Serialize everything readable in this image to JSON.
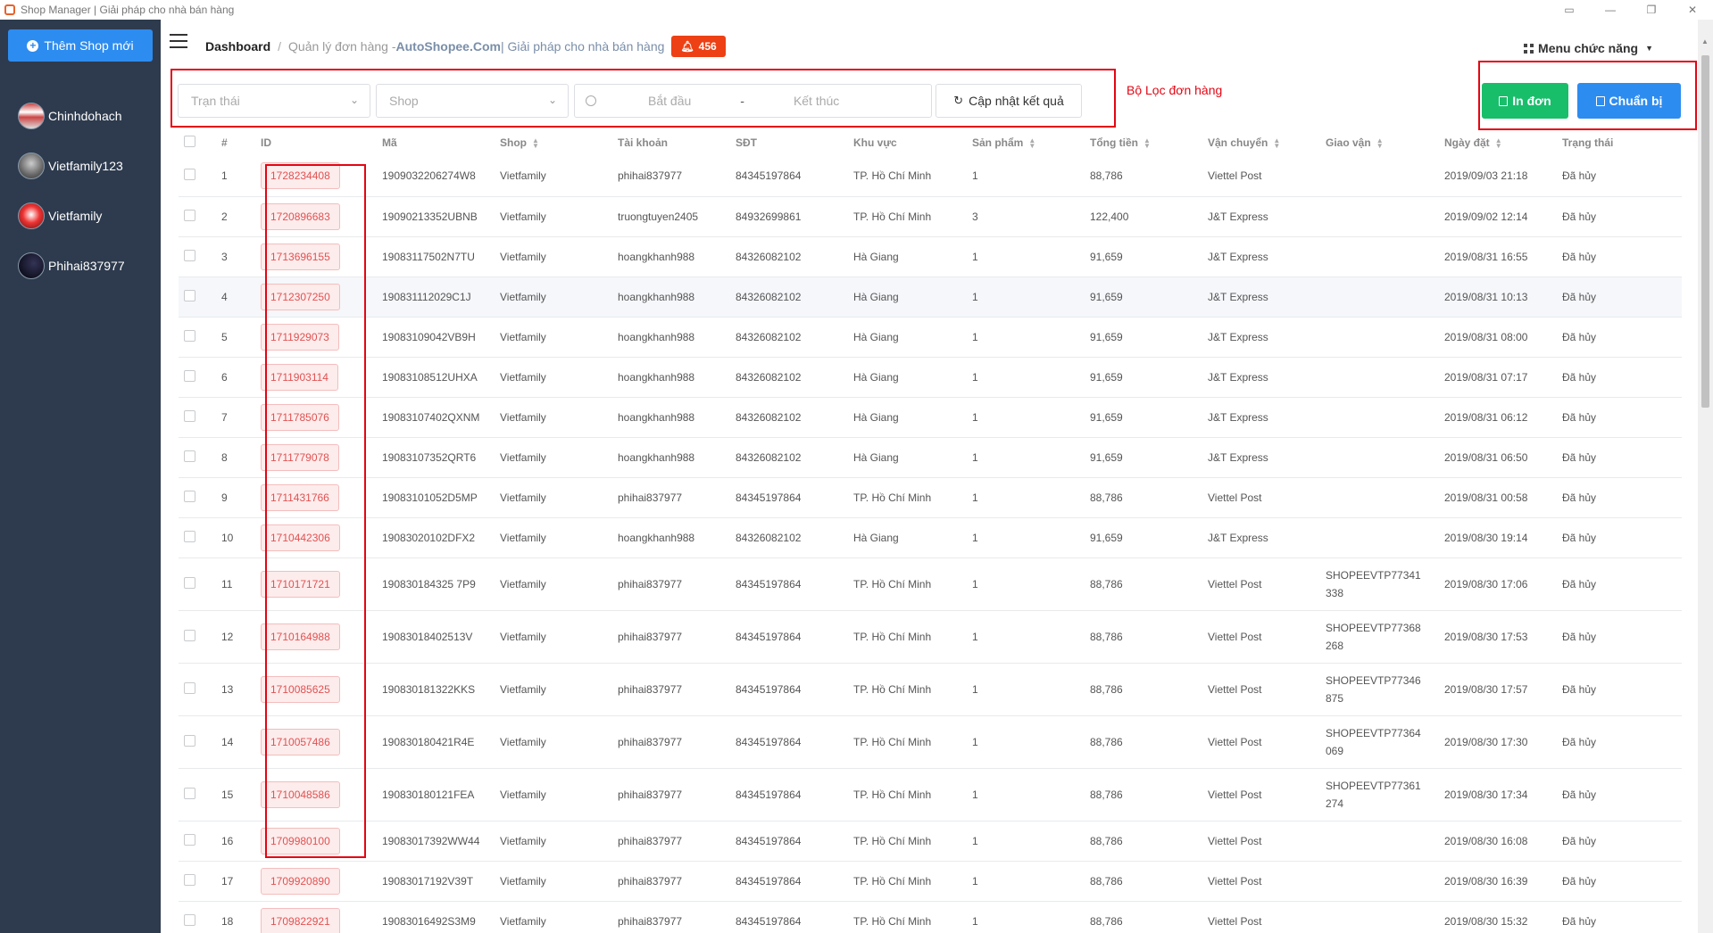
{
  "window": {
    "title": "Shop Manager | Giải pháp cho nhà bán hàng",
    "controls": [
      "▭",
      "—",
      "❐",
      "✕"
    ]
  },
  "sidebar": {
    "add_shop_label": "Thêm Shop mới",
    "shops": [
      {
        "name": "Chinhdohach"
      },
      {
        "name": "Vietfamily123"
      },
      {
        "name": "Vietfamily"
      },
      {
        "name": "Phihai837977"
      }
    ]
  },
  "header": {
    "breadcrumb_home": "Dashboard",
    "breadcrumb_sep": "/",
    "breadcrumb_page": "Quản lý đơn hàng - ",
    "breadcrumb_brand": "AutoShopee.Com",
    "breadcrumb_tail": " | Giải pháp cho nhà bán hàng",
    "notification_count": "456",
    "menu_label": "Menu chức năng"
  },
  "filters": {
    "status_placeholder": "Trạn thái",
    "shop_placeholder": "Shop",
    "start_placeholder": "Bắt đầu",
    "range_sep": "-",
    "end_placeholder": "Kết thúc",
    "refresh_label": "Cập nhật kết quả",
    "annotation": "Bộ Lọc đơn hàng"
  },
  "actions": {
    "print_label": "In đơn",
    "prepare_label": "Chuẩn bị"
  },
  "table": {
    "columns": [
      "#",
      "ID",
      "Mã",
      "Shop",
      "Tài khoản",
      "SĐT",
      "Khu vực",
      "Sản phẩm",
      "Tổng tiền",
      "Vận chuyển",
      "Giao vận",
      "Ngày đặt",
      "Trạng thái"
    ],
    "sortable": [
      false,
      false,
      false,
      true,
      false,
      false,
      false,
      true,
      true,
      true,
      true,
      true,
      false
    ],
    "rows": [
      {
        "num": "1",
        "id": "1728234408",
        "code": "1909032206274W8",
        "shop": "Vietfamily",
        "account": "phihai837977",
        "phone": "84345197864",
        "region": "TP. Hồ Chí Minh",
        "products": "1",
        "total": "88,786",
        "shipping": "Viettel Post",
        "tracking": "",
        "date": "2019/09/03 21:18",
        "status": "Đã hủy"
      },
      {
        "num": "2",
        "id": "1720896683",
        "code": "19090213352UBNB",
        "shop": "Vietfamily",
        "account": "truongtuyen2405",
        "phone": "84932699861",
        "region": "TP. Hồ Chí Minh",
        "products": "3",
        "total": "122,400",
        "shipping": "J&T Express",
        "tracking": "",
        "date": "2019/09/02 12:14",
        "status": "Đã hủy"
      },
      {
        "num": "3",
        "id": "1713696155",
        "code": "19083117502N7TU",
        "shop": "Vietfamily",
        "account": "hoangkhanh988",
        "phone": "84326082102",
        "region": "Hà Giang",
        "products": "1",
        "total": "91,659",
        "shipping": "J&T Express",
        "tracking": "",
        "date": "2019/08/31 16:55",
        "status": "Đã hủy"
      },
      {
        "num": "4",
        "id": "1712307250",
        "code": "190831112029C1J",
        "shop": "Vietfamily",
        "account": "hoangkhanh988",
        "phone": "84326082102",
        "region": "Hà Giang",
        "products": "1",
        "total": "91,659",
        "shipping": "J&T Express",
        "tracking": "",
        "date": "2019/08/31 10:13",
        "status": "Đã hủy"
      },
      {
        "num": "5",
        "id": "1711929073",
        "code": "19083109042VB9H",
        "shop": "Vietfamily",
        "account": "hoangkhanh988",
        "phone": "84326082102",
        "region": "Hà Giang",
        "products": "1",
        "total": "91,659",
        "shipping": "J&T Express",
        "tracking": "",
        "date": "2019/08/31 08:00",
        "status": "Đã hủy"
      },
      {
        "num": "6",
        "id": "1711903114",
        "code": "19083108512UHXA",
        "shop": "Vietfamily",
        "account": "hoangkhanh988",
        "phone": "84326082102",
        "region": "Hà Giang",
        "products": "1",
        "total": "91,659",
        "shipping": "J&T Express",
        "tracking": "",
        "date": "2019/08/31 07:17",
        "status": "Đã hủy"
      },
      {
        "num": "7",
        "id": "1711785076",
        "code": "19083107402QXNM",
        "shop": "Vietfamily",
        "account": "hoangkhanh988",
        "phone": "84326082102",
        "region": "Hà Giang",
        "products": "1",
        "total": "91,659",
        "shipping": "J&T Express",
        "tracking": "",
        "date": "2019/08/31 06:12",
        "status": "Đã hủy"
      },
      {
        "num": "8",
        "id": "1711779078",
        "code": "19083107352QRT6",
        "shop": "Vietfamily",
        "account": "hoangkhanh988",
        "phone": "84326082102",
        "region": "Hà Giang",
        "products": "1",
        "total": "91,659",
        "shipping": "J&T Express",
        "tracking": "",
        "date": "2019/08/31 06:50",
        "status": "Đã hủy"
      },
      {
        "num": "9",
        "id": "1711431766",
        "code": "19083101052D5MP",
        "shop": "Vietfamily",
        "account": "phihai837977",
        "phone": "84345197864",
        "region": "TP. Hồ Chí Minh",
        "products": "1",
        "total": "88,786",
        "shipping": "Viettel Post",
        "tracking": "",
        "date": "2019/08/31 00:58",
        "status": "Đã hủy"
      },
      {
        "num": "10",
        "id": "1710442306",
        "code": "19083020102DFX2",
        "shop": "Vietfamily",
        "account": "hoangkhanh988",
        "phone": "84326082102",
        "region": "Hà Giang",
        "products": "1",
        "total": "91,659",
        "shipping": "J&T Express",
        "tracking": "",
        "date": "2019/08/30 19:14",
        "status": "Đã hủy"
      },
      {
        "num": "11",
        "id": "1710171721",
        "code": "190830184325 7P9",
        "shop": "Vietfamily",
        "account": "phihai837977",
        "phone": "84345197864",
        "region": "TP. Hồ Chí Minh",
        "products": "1",
        "total": "88,786",
        "shipping": "Viettel Post",
        "tracking": "SHOPEEVTP77341 338",
        "date": "2019/08/30 17:06",
        "status": "Đã hủy"
      },
      {
        "num": "12",
        "id": "1710164988",
        "code": "19083018402513V",
        "shop": "Vietfamily",
        "account": "phihai837977",
        "phone": "84345197864",
        "region": "TP. Hồ Chí Minh",
        "products": "1",
        "total": "88,786",
        "shipping": "Viettel Post",
        "tracking": "SHOPEEVTP77368 268",
        "date": "2019/08/30 17:53",
        "status": "Đã hủy"
      },
      {
        "num": "13",
        "id": "1710085625",
        "code": "190830181322KKS",
        "shop": "Vietfamily",
        "account": "phihai837977",
        "phone": "84345197864",
        "region": "TP. Hồ Chí Minh",
        "products": "1",
        "total": "88,786",
        "shipping": "Viettel Post",
        "tracking": "SHOPEEVTP77346 875",
        "date": "2019/08/30 17:57",
        "status": "Đã hủy"
      },
      {
        "num": "14",
        "id": "1710057486",
        "code": "190830180421R4E",
        "shop": "Vietfamily",
        "account": "phihai837977",
        "phone": "84345197864",
        "region": "TP. Hồ Chí Minh",
        "products": "1",
        "total": "88,786",
        "shipping": "Viettel Post",
        "tracking": "SHOPEEVTP77364 069",
        "date": "2019/08/30 17:30",
        "status": "Đã hủy"
      },
      {
        "num": "15",
        "id": "1710048586",
        "code": "190830180121FEA",
        "shop": "Vietfamily",
        "account": "phihai837977",
        "phone": "84345197864",
        "region": "TP. Hồ Chí Minh",
        "products": "1",
        "total": "88,786",
        "shipping": "Viettel Post",
        "tracking": "SHOPEEVTP77361 274",
        "date": "2019/08/30 17:34",
        "status": "Đã hủy"
      },
      {
        "num": "16",
        "id": "1709980100",
        "code": "19083017392WW44",
        "shop": "Vietfamily",
        "account": "phihai837977",
        "phone": "84345197864",
        "region": "TP. Hồ Chí Minh",
        "products": "1",
        "total": "88,786",
        "shipping": "Viettel Post",
        "tracking": "",
        "date": "2019/08/30 16:08",
        "status": "Đã hủy"
      },
      {
        "num": "17",
        "id": "1709920890",
        "code": "19083017192V39T",
        "shop": "Vietfamily",
        "account": "phihai837977",
        "phone": "84345197864",
        "region": "TP. Hồ Chí Minh",
        "products": "1",
        "total": "88,786",
        "shipping": "Viettel Post",
        "tracking": "",
        "date": "2019/08/30 16:39",
        "status": "Đã hủy"
      },
      {
        "num": "18",
        "id": "1709822921",
        "code": "19083016492S3M9",
        "shop": "Vietfamily",
        "account": "phihai837977",
        "phone": "84345197864",
        "region": "TP. Hồ Chí Minh",
        "products": "1",
        "total": "88,786",
        "shipping": "Viettel Post",
        "tracking": "",
        "date": "2019/08/30 15:32",
        "status": "Đã hủy"
      }
    ]
  },
  "colors": {
    "sidebar_bg": "#2e3b4e",
    "primary": "#2d8cf0",
    "success": "#19be6b",
    "danger": "#ed4014",
    "annotation_red": "#e30613"
  }
}
